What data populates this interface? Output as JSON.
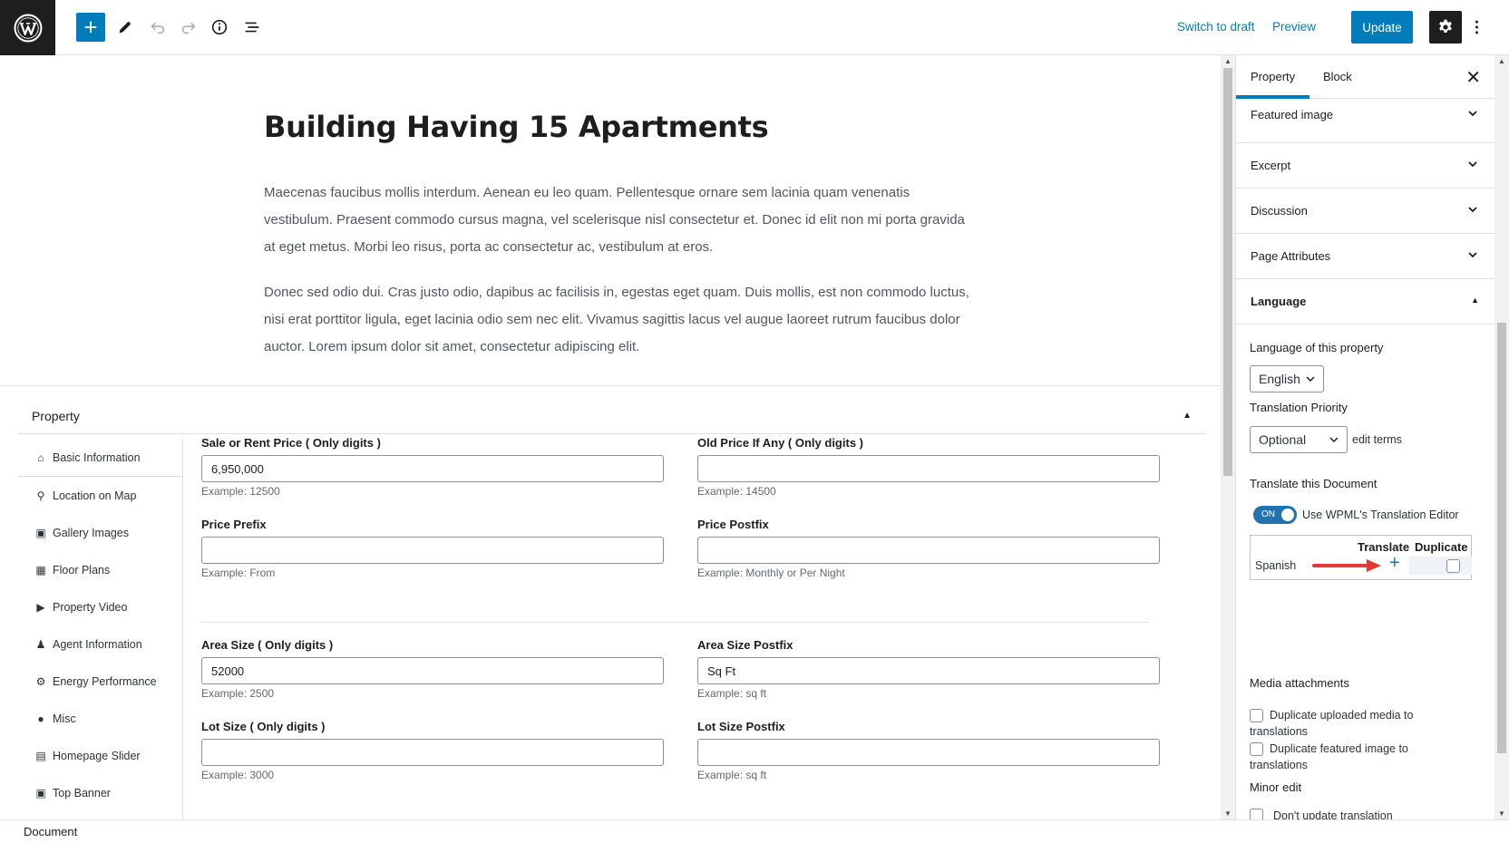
{
  "topbar": {
    "switch_to_draft": "Switch to draft",
    "preview": "Preview",
    "update": "Update"
  },
  "post": {
    "title": "Building Having 15 Apartments",
    "paragraphs": [
      "Maecenas faucibus mollis interdum. Aenean eu leo quam. Pellentesque ornare sem lacinia quam venenatis vestibulum. Praesent commodo cursus magna, vel scelerisque nisl consectetur et. Donec id elit non mi porta gravida at eget metus. Morbi leo risus, porta ac consectetur ac, vestibulum at eros.",
      "Donec sed odio dui. Cras justo odio, dapibus ac facilisis in, egestas eget quam. Duis mollis, est non commodo luctus, nisi erat porttitor ligula, eget lacinia odio sem nec elit. Vivamus sagittis lacus vel augue laoreet rutrum faucibus dolor auctor. Lorem ipsum dolor sit amet, consectetur adipiscing elit."
    ]
  },
  "metabox": {
    "title": "Property",
    "tabs": [
      {
        "label": "Basic Information",
        "icon": "home-icon"
      },
      {
        "label": "Location on Map",
        "icon": "map-pin-icon"
      },
      {
        "label": "Gallery Images",
        "icon": "gallery-icon"
      },
      {
        "label": "Floor Plans",
        "icon": "floor-plan-icon"
      },
      {
        "label": "Property Video",
        "icon": "video-icon"
      },
      {
        "label": "Agent Information",
        "icon": "agent-icon"
      },
      {
        "label": "Energy Performance",
        "icon": "energy-icon"
      },
      {
        "label": "Misc",
        "icon": "bulb-icon"
      },
      {
        "label": "Homepage Slider",
        "icon": "slider-icon"
      },
      {
        "label": "Top Banner",
        "icon": "banner-icon"
      }
    ],
    "fields": {
      "sale_price": {
        "label": "Sale or Rent Price ( Only digits )",
        "value": "6,950,000",
        "help": "Example: 12500"
      },
      "old_price": {
        "label": "Old Price If Any ( Only digits )",
        "value": "",
        "help": "Example: 14500"
      },
      "price_prefix": {
        "label": "Price Prefix",
        "value": "",
        "help": "Example: From"
      },
      "price_postfix": {
        "label": "Price Postfix",
        "value": "",
        "help": "Example: Monthly or Per Night"
      },
      "area_size": {
        "label": "Area Size ( Only digits )",
        "value": "52000",
        "help": "Example: 2500"
      },
      "area_postfix": {
        "label": "Area Size Postfix",
        "value": "Sq Ft",
        "help": "Example: sq ft"
      },
      "lot_size": {
        "label": "Lot Size ( Only digits )",
        "value": "",
        "help": "Example: 3000"
      },
      "lot_postfix": {
        "label": "Lot Size Postfix",
        "value": "",
        "help": "Example: sq ft"
      }
    }
  },
  "sidebar": {
    "tabs": [
      "Property",
      "Block"
    ],
    "panels": [
      "Featured image",
      "Excerpt",
      "Discussion",
      "Page Attributes",
      "Language"
    ],
    "language": {
      "label": "Language of this property",
      "value": "English",
      "priority_label": "Translation Priority",
      "priority_value": "Optional",
      "edit_terms": "edit terms",
      "translate_doc": "Translate this Document",
      "toggle_state": "ON",
      "toggle_label": "Use WPML's Translation Editor",
      "col_translate": "Translate",
      "col_duplicate": "Duplicate",
      "row_language": "Spanish",
      "media_label": "Media attachments",
      "dup_media": "Duplicate uploaded media to translations",
      "dup_featured": "Duplicate featured image to translations",
      "minor_edit": "Minor edit",
      "dont_update": "Don't update translation"
    }
  },
  "footer": {
    "breadcrumb": "Document"
  },
  "colors": {
    "accent": "#007cba",
    "dark": "#1e1e1e",
    "arrow": "#e53935"
  }
}
